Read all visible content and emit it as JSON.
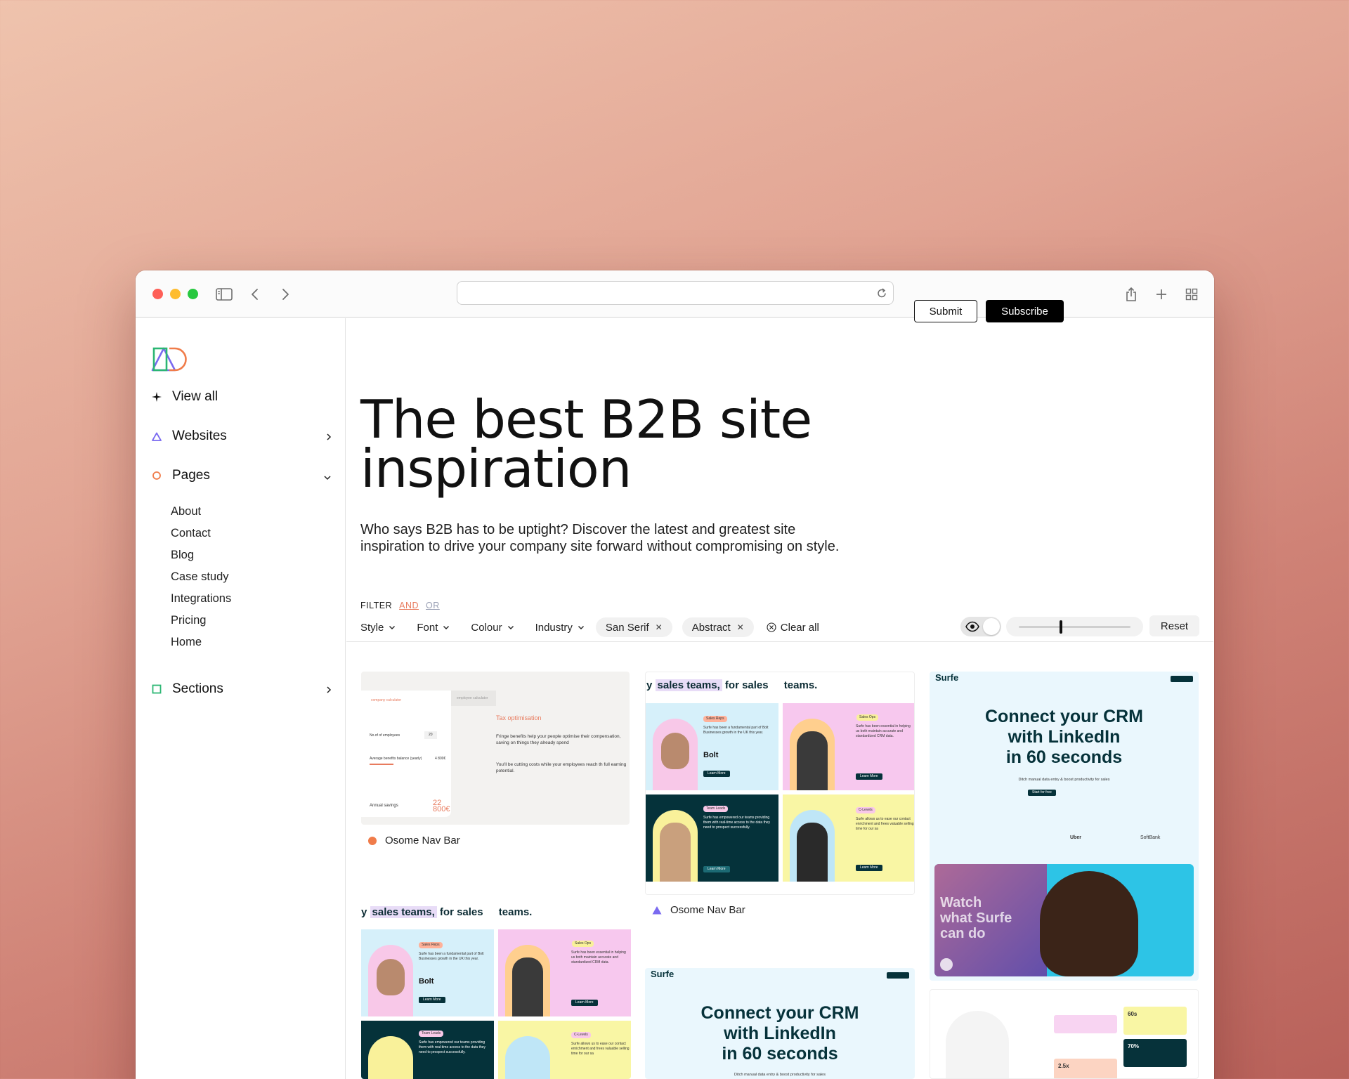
{
  "browser": {
    "url": ""
  },
  "sidebar": {
    "view_all": "View all",
    "websites": "Websites",
    "pages": "Pages",
    "page_items": [
      "About",
      "Contact",
      "Blog",
      "Case study",
      "Integrations",
      "Pricing",
      "Home"
    ],
    "sections": "Sections"
  },
  "header": {
    "submit": "Submit",
    "subscribe": "Subscribe"
  },
  "hero": {
    "title_line1": "The best B2B site",
    "title_line2": "inspiration",
    "subtitle": "Who says B2B has to be uptight? Discover the latest and greatest site inspiration to drive your company site forward without compromising on style."
  },
  "filter": {
    "label": "FILTER",
    "and": "AND",
    "or": "OR",
    "dropdowns": [
      "Style",
      "Font",
      "Colour",
      "Industry"
    ],
    "tags": [
      "San Serif",
      "Abstract"
    ],
    "clear_all": "Clear all",
    "reset": "Reset",
    "size_level": 0.38
  },
  "cards": {
    "card1_label": "Osome Nav Bar",
    "card2_label": "Osome Nav Bar",
    "tax": {
      "tab1": "company calculator",
      "tab2": "employee calculator",
      "field1": "No.of of employees",
      "field1_value": "20",
      "field2": "Average benefits balance (yearly)",
      "field2_value": "4 800€",
      "savings_label": "Annual savings",
      "savings_value": "22 800€",
      "title": "Tax optimisation",
      "body1": "Fringe benefits help your people optimise their compensation, saving on things they already spend",
      "body2": "You'll be cutting costs while your employees reach th full earning potential."
    },
    "sales": {
      "heading_a": "y",
      "heading_b": "sales teams,",
      "heading_c": "for sales",
      "heading_d": "teams.",
      "tile1_tag": "Sales Reps",
      "tile1_text": "Surfe has been a fundamental part of Bolt Businesses growth in the UK this year.",
      "tile2_tag": "Sales Ops",
      "tile2_text": "Surfe has been essential in helping us both maintain accurate and standardized CRM data.",
      "tile3_tag": "Team Leads",
      "tile3_text": "Surfe has empowered our teams providing them with real-time access to the data they need to prospect successfully.",
      "tile4_tag": "C-Levels",
      "tile4_text": "Surfe allows us to ease our contact enrichment and frees valuable selling time for our sa",
      "learn_more": "Learn More",
      "bolt": "Bolt"
    },
    "surfe": {
      "brand": "Surfe",
      "line1": "Connect your CRM",
      "line2": "with LinkedIn",
      "line3": "in 60 seconds",
      "tagline": "Ditch manual data entry & boost productivity for sales",
      "cta": "Start for free",
      "video_line1": "Watch",
      "video_line2": "what Surfe",
      "video_line3": "can do",
      "logos": [
        "Uber",
        "SoftBank"
      ],
      "stat1": "60s",
      "stat2": "70%",
      "stat3": "2.5x"
    }
  }
}
